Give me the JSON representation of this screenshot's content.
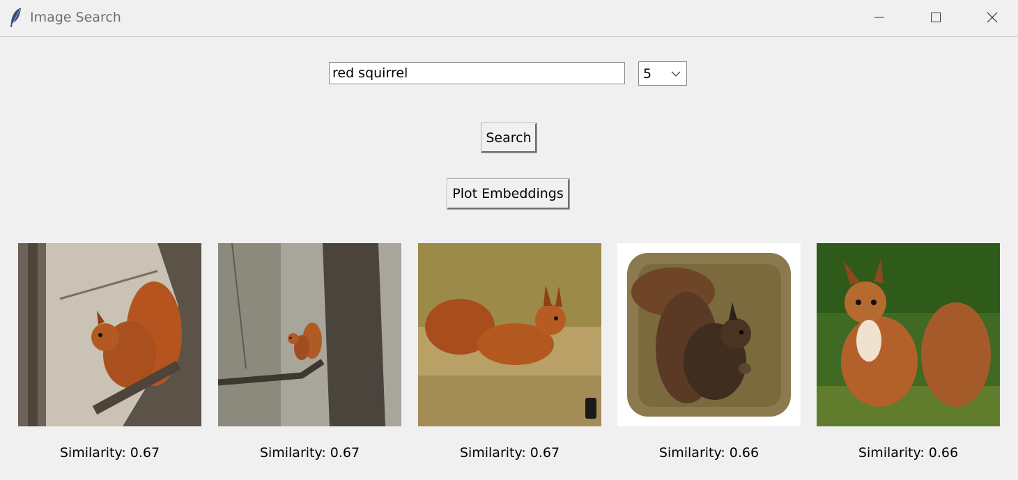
{
  "window": {
    "title": "Image Search",
    "controls": {
      "minimize_icon": "minimize-icon",
      "maximize_icon": "maximize-icon",
      "close_icon": "close-icon"
    }
  },
  "search": {
    "query_value": "red squirrel",
    "count_value": "5",
    "search_button_label": "Search",
    "plot_button_label": "Plot Embeddings"
  },
  "results": [
    {
      "similarity_label": "Similarity: 0.67",
      "similarity": 0.67
    },
    {
      "similarity_label": "Similarity: 0.67",
      "similarity": 0.67
    },
    {
      "similarity_label": "Similarity: 0.67",
      "similarity": 0.67
    },
    {
      "similarity_label": "Similarity: 0.66",
      "similarity": 0.66
    },
    {
      "similarity_label": "Similarity: 0.66",
      "similarity": 0.66
    }
  ],
  "colors": {
    "window_bg": "#f0f0f0",
    "title_text": "#6e6e6e",
    "squirrel_fur": "#b5541e",
    "icon_blue": "#3a4a7a"
  }
}
